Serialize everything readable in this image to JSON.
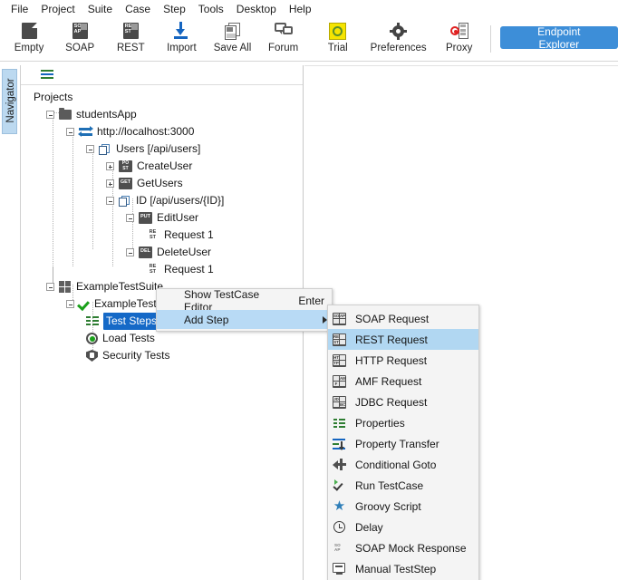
{
  "menubar": {
    "items": [
      "File",
      "Project",
      "Suite",
      "Case",
      "Step",
      "Tools",
      "Desktop",
      "Help"
    ]
  },
  "toolbar": {
    "buttons": [
      {
        "label": "Empty",
        "icon": "empty-project-icon"
      },
      {
        "label": "SOAP",
        "icon": "soap-project-icon"
      },
      {
        "label": "REST",
        "icon": "rest-project-icon"
      },
      {
        "label": "Import",
        "icon": "import-icon"
      },
      {
        "label": "Save All",
        "icon": "save-all-icon"
      },
      {
        "label": "Forum",
        "icon": "forum-icon"
      },
      {
        "label": "Trial",
        "icon": "trial-icon"
      },
      {
        "label": "Preferences",
        "icon": "gear-icon"
      },
      {
        "label": "Proxy",
        "icon": "proxy-icon"
      }
    ],
    "endpoint_explorer_label": "Endpoint Explorer",
    "accent_color": "#3d8ed8"
  },
  "navigator": {
    "tab_label": "Navigator",
    "panel_toolbar_icon": "properties-icon",
    "root_label": "Projects",
    "tree": [
      {
        "label": "studentsApp",
        "icon": "folder-icon",
        "indent": 0,
        "handle": "minus"
      },
      {
        "label": "http://localhost:3000",
        "icon": "interface-icon",
        "indent": 1,
        "handle": "minus"
      },
      {
        "label": "Users [/api/users]",
        "icon": "resource-icon",
        "indent": 2,
        "handle": "minus"
      },
      {
        "label": "CreateUser",
        "icon": "post-method-icon",
        "indent": 3,
        "handle": "plus"
      },
      {
        "label": "GetUsers",
        "icon": "get-method-icon",
        "indent": 3,
        "handle": "plus"
      },
      {
        "label": "ID [/api/users/{ID}]",
        "icon": "resource-icon",
        "indent": 3,
        "handle": "minus"
      },
      {
        "label": "EditUser",
        "icon": "put-method-icon",
        "indent": 4,
        "handle": "minus"
      },
      {
        "label": "Request 1",
        "icon": "rest-request-icon",
        "indent": 5,
        "handle": "none"
      },
      {
        "label": "DeleteUser",
        "icon": "del-method-icon",
        "indent": 4,
        "handle": "minus"
      },
      {
        "label": "Request 1",
        "icon": "rest-request-icon",
        "indent": 5,
        "handle": "none"
      },
      {
        "label": "ExampleTestSuite",
        "icon": "testsuite-icon",
        "indent": 0,
        "handle": "minus"
      },
      {
        "label": "ExampleTestCase",
        "icon": "testcase-icon",
        "indent": 1,
        "handle": "minus"
      },
      {
        "label": "Test Steps (0)",
        "icon": "test-steps-icon",
        "indent": 2,
        "handle": "none",
        "selected": true
      },
      {
        "label": "Load Tests",
        "icon": "load-tests-icon",
        "indent": 2,
        "handle": "none"
      },
      {
        "label": "Security Tests",
        "icon": "security-tests-icon",
        "indent": 2,
        "handle": "none"
      }
    ]
  },
  "context_menu": {
    "items": [
      {
        "label": "Show TestCase Editor",
        "accel": "Enter",
        "highlighted": false,
        "submenu": false
      },
      {
        "label": "Add Step",
        "accel": "",
        "highlighted": true,
        "submenu": true
      }
    ]
  },
  "submenu": {
    "items": [
      {
        "label": "SOAP Request",
        "icon": "soap-request-icon",
        "glyph": [
          "SO",
          "AP"
        ],
        "highlighted": false
      },
      {
        "label": "REST Request",
        "icon": "rest-request-icon",
        "glyph": [
          "RE",
          "ST"
        ],
        "highlighted": true
      },
      {
        "label": "HTTP Request",
        "icon": "http-request-icon",
        "glyph": [
          "HT",
          "TP"
        ],
        "highlighted": false
      },
      {
        "label": "AMF Request",
        "icon": "amf-request-icon",
        "glyph": [
          "AM",
          "F"
        ],
        "highlighted": false
      },
      {
        "label": "JDBC Request",
        "icon": "jdbc-request-icon",
        "glyph": [
          "JD",
          "BC"
        ],
        "highlighted": false
      },
      {
        "label": "Properties",
        "icon": "properties-icon",
        "highlighted": false
      },
      {
        "label": "Property Transfer",
        "icon": "property-transfer-icon",
        "highlighted": false
      },
      {
        "label": "Conditional Goto",
        "icon": "conditional-goto-icon",
        "highlighted": false
      },
      {
        "label": "Run TestCase",
        "icon": "run-testcase-icon",
        "highlighted": false
      },
      {
        "label": "Groovy Script",
        "icon": "groovy-script-icon",
        "highlighted": false
      },
      {
        "label": "Delay",
        "icon": "delay-clock-icon",
        "highlighted": false
      },
      {
        "label": "SOAP Mock Response",
        "icon": "soap-mock-response-icon",
        "highlighted": false
      },
      {
        "label": "Manual TestStep",
        "icon": "manual-teststep-icon",
        "highlighted": false
      }
    ]
  },
  "colors": {
    "selection_blue": "#1569c7",
    "menu_highlight": "#b1d7f2",
    "tab_blue": "#bcd9f0"
  }
}
